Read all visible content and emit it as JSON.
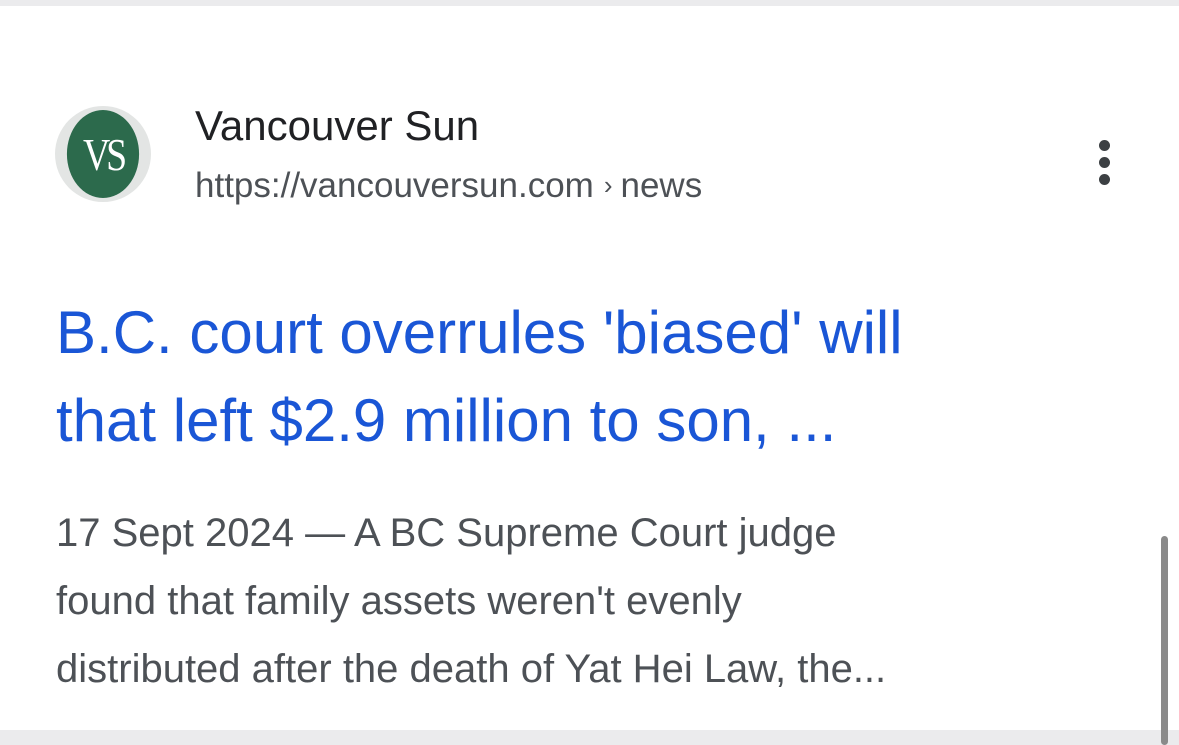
{
  "result": {
    "favicon_text": "VS",
    "site_name": "Vancouver Sun",
    "url": "https://vancouversun.com",
    "breadcrumb_separator": "›",
    "breadcrumb_path": "news",
    "title": "B.C. court overrules 'biased' will\nthat left $2.9 million to son, ...",
    "snippet": "17 Sept 2024 — A BC Supreme Court judge\nfound that family assets weren't evenly\ndistributed after the death of Yat Hei Law, the..."
  },
  "colors": {
    "title_link": "#1a56d6",
    "favicon_bg": "#2c6a4c",
    "snippet_text": "#4d5156",
    "page_bg": "#ebebed"
  },
  "icons": {
    "more": "more-vert-icon"
  }
}
